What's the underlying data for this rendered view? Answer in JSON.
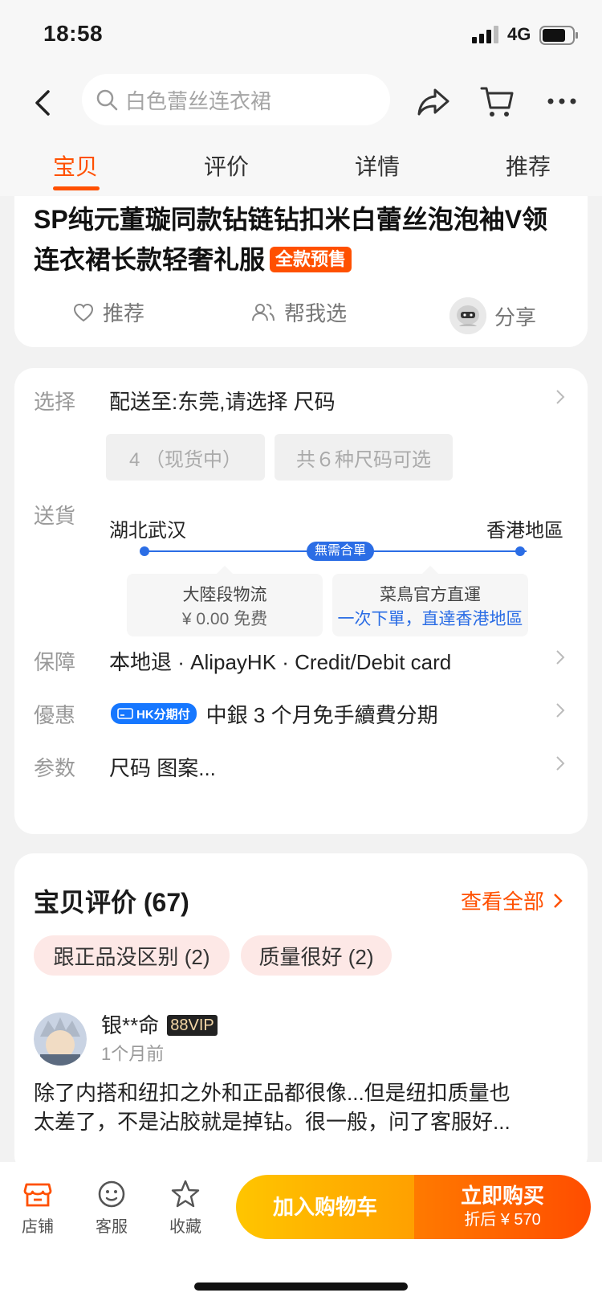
{
  "status_bar": {
    "time": "18:58",
    "network": "4G"
  },
  "search": {
    "placeholder": "白色蕾丝连衣裙"
  },
  "tabs": [
    {
      "label": "宝贝"
    },
    {
      "label": "评价"
    },
    {
      "label": "详情"
    },
    {
      "label": "推荐"
    }
  ],
  "product": {
    "title": "SP纯元董璇同款钻链钻扣米白蕾丝泡泡袖V领连衣裙长款轻奢礼服",
    "presale_badge": "全款预售",
    "actions": {
      "recommend": "推荐",
      "help_choose": "帮我选",
      "share": "分享"
    }
  },
  "options": {
    "select_label": "选择",
    "select_value": "配送至:东莞,请选择 尺码",
    "size_chip_1": "4 （现货中）",
    "size_chip_2": "共６种尺码可选",
    "shipping_label": "送貨",
    "route_from": "湖北武汉",
    "route_to": "香港地區",
    "route_badge": "無需合單",
    "ship_box_1_line1": "大陸段物流",
    "ship_box_1_line2": "¥ 0.00 免费",
    "ship_box_2_line1": "菜鳥官方直運",
    "ship_box_2_line2": "一次下單，直達香港地區",
    "guarantee_label": "保障",
    "guarantee_value": "本地退 · AlipayHK · Credit/Debit card",
    "discount_label": "優惠",
    "discount_badge": "HK分期付",
    "discount_value": "中銀 3 个月免手續費分期",
    "params_label": "参数",
    "params_value": "尺码 图案..."
  },
  "reviews": {
    "title": "宝贝评价 (67)",
    "view_all": "查看全部",
    "tags": [
      "跟正品没区别 (2)",
      "质量很好 (2)"
    ],
    "items": [
      {
        "name": "银**命",
        "vip": "88VIP",
        "time": "1个月前",
        "text_line1": "除了内搭和纽扣之外和正品都很像...但是纽扣质量也",
        "text_line2": "太差了，不是沾胶就是掉钻。很一般，问了客服好..."
      }
    ]
  },
  "bottom_bar": {
    "store": "店铺",
    "service": "客服",
    "favorite": "收藏",
    "add_to_cart": "加入购物车",
    "buy_now": "立即购买",
    "buy_price": "折后 ¥ 570"
  },
  "colors": {
    "accent": "#ff5000",
    "blue": "#2b6de5"
  }
}
